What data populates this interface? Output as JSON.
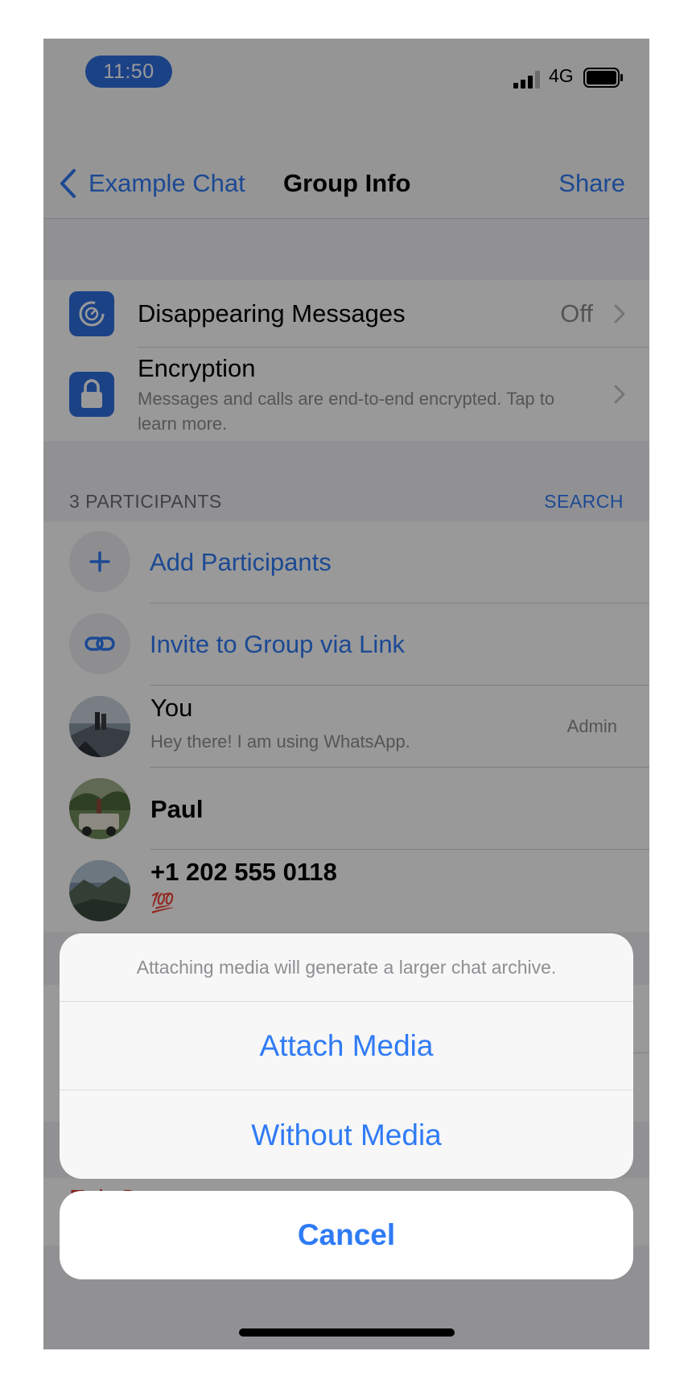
{
  "status": {
    "time": "11:50",
    "network": "4G"
  },
  "nav": {
    "back_label": "Example Chat",
    "title": "Group Info",
    "share_label": "Share"
  },
  "settings": {
    "disappearing": {
      "title": "Disappearing Messages",
      "value": "Off"
    },
    "encryption": {
      "title": "Encryption",
      "subtitle": "Messages and calls are end-to-end encrypted. Tap to learn more."
    }
  },
  "participants": {
    "header": "3 PARTICIPANTS",
    "search_label": "SEARCH",
    "add_label": "Add Participants",
    "invite_label": "Invite to Group via Link",
    "list": [
      {
        "name": "You",
        "status": "Hey there! I am using WhatsApp.",
        "role": "Admin"
      },
      {
        "name": "Paul",
        "status": "",
        "role": ""
      },
      {
        "name": "+1 202 555 0118",
        "status": "💯",
        "role": ""
      }
    ]
  },
  "exit_label": "Exit Group",
  "action_sheet": {
    "message": "Attaching media will generate a larger chat archive.",
    "attach_label": "Attach Media",
    "without_label": "Without Media",
    "cancel_label": "Cancel"
  },
  "colors": {
    "accent": "#2f7bf5",
    "tile_blue": "#2f6fe0",
    "destructive": "#e0382d"
  }
}
